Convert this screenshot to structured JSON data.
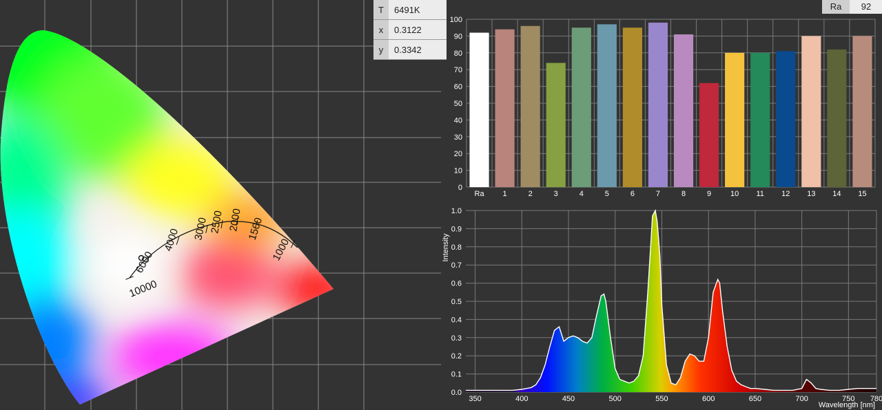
{
  "readout": {
    "t_label": "T",
    "t_value": "6491K",
    "x_label": "x",
    "x_value": "0.3122",
    "y_label": "y",
    "y_value": "0.3342"
  },
  "ra_badge": {
    "label": "Ra",
    "value": "92"
  },
  "chart_data": [
    {
      "type": "scatter",
      "name": "CIE 1931 chromaticity diagram",
      "point": {
        "x": 0.3122,
        "y": 0.3342
      },
      "planckian_labels": [
        "10000",
        "6000",
        "4000",
        "3000",
        "2500",
        "2000",
        "1500",
        "1000"
      ],
      "grid": true
    },
    {
      "type": "bar",
      "categories": [
        "Ra",
        "1",
        "2",
        "3",
        "4",
        "5",
        "6",
        "7",
        "8",
        "9",
        "10",
        "11",
        "12",
        "13",
        "14",
        "15"
      ],
      "values": [
        92,
        94,
        96,
        74,
        95,
        97,
        95,
        98,
        91,
        62,
        80,
        80,
        81,
        90,
        82,
        90
      ],
      "colors": [
        "#ffffff",
        "#b8847c",
        "#a08c62",
        "#86a042",
        "#6c9c78",
        "#6a9aac",
        "#b08c2a",
        "#9a86cc",
        "#b88abf",
        "#c0283c",
        "#f4c23c",
        "#248a5a",
        "#0a4a8e",
        "#f0c0a8",
        "#5c6438",
        "#b88c7c"
      ],
      "yticks": [
        0,
        10,
        20,
        30,
        40,
        50,
        60,
        70,
        80,
        90,
        100
      ],
      "ylim": [
        0,
        100
      ],
      "grid": true
    },
    {
      "type": "area",
      "xlabel": "Wavelength [nm]",
      "ylabel": "Intensity",
      "xlim": [
        340,
        780
      ],
      "ylim": [
        0,
        1.0
      ],
      "xticks": [
        350,
        400,
        450,
        500,
        550,
        600,
        650,
        700,
        750,
        780
      ],
      "yticks": [
        "0.0",
        "0.1",
        "0.2",
        "0.3",
        "0.4",
        "0.5",
        "0.6",
        "0.7",
        "0.8",
        "0.9",
        "1.0"
      ],
      "x": [
        340,
        350,
        360,
        370,
        380,
        390,
        400,
        405,
        410,
        415,
        420,
        425,
        430,
        435,
        440,
        445,
        450,
        455,
        460,
        465,
        470,
        475,
        480,
        485,
        488,
        490,
        495,
        500,
        505,
        510,
        515,
        520,
        525,
        530,
        535,
        538,
        540,
        543,
        545,
        548,
        550,
        555,
        560,
        565,
        570,
        575,
        580,
        585,
        590,
        595,
        600,
        605,
        610,
        612,
        615,
        620,
        625,
        630,
        635,
        640,
        645,
        650,
        660,
        670,
        680,
        690,
        700,
        705,
        710,
        715,
        720,
        730,
        740,
        750,
        760,
        770,
        780
      ],
      "values": [
        0.01,
        0.01,
        0.01,
        0.01,
        0.01,
        0.01,
        0.015,
        0.02,
        0.025,
        0.04,
        0.08,
        0.15,
        0.25,
        0.34,
        0.36,
        0.28,
        0.3,
        0.31,
        0.3,
        0.28,
        0.27,
        0.3,
        0.42,
        0.53,
        0.54,
        0.5,
        0.3,
        0.13,
        0.07,
        0.06,
        0.05,
        0.06,
        0.09,
        0.2,
        0.55,
        0.8,
        0.97,
        1.0,
        0.94,
        0.75,
        0.48,
        0.15,
        0.05,
        0.04,
        0.08,
        0.17,
        0.21,
        0.2,
        0.17,
        0.17,
        0.3,
        0.55,
        0.62,
        0.6,
        0.45,
        0.25,
        0.12,
        0.06,
        0.04,
        0.03,
        0.02,
        0.02,
        0.015,
        0.01,
        0.01,
        0.01,
        0.02,
        0.07,
        0.05,
        0.02,
        0.015,
        0.01,
        0.01,
        0.015,
        0.02,
        0.02,
        0.02
      ],
      "grid": true
    }
  ]
}
